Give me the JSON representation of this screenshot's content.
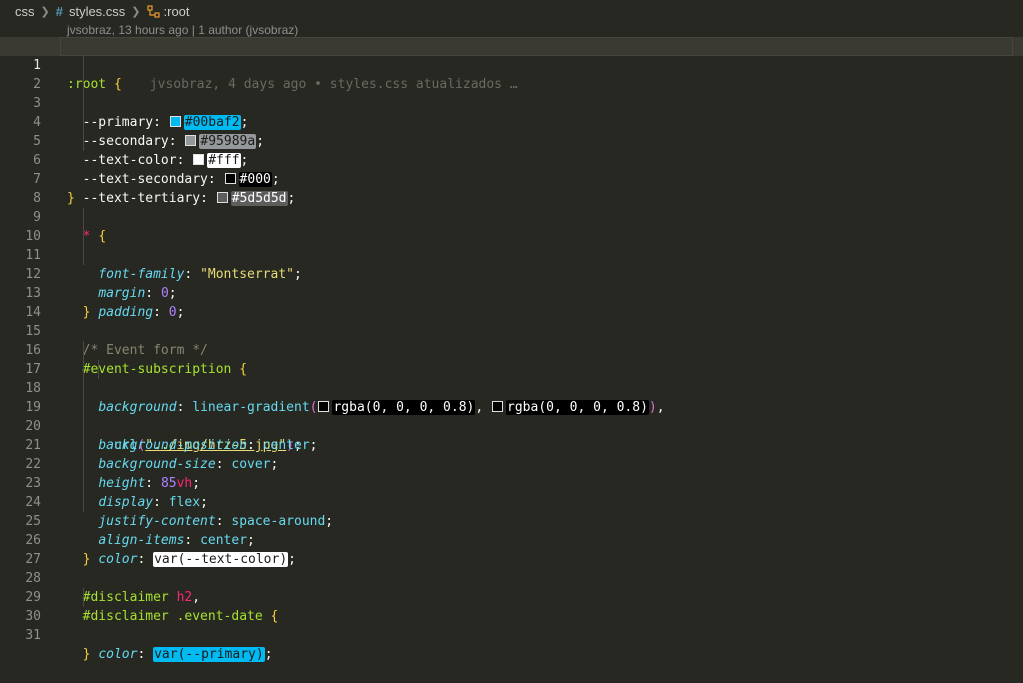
{
  "breadcrumb": {
    "folder": "css",
    "file": "styles.css",
    "symbol": ":root"
  },
  "codelens": "jvsobraz, 13 hours ago | 1 author (jvsobraz)",
  "blame": "jvsobraz, 4 days ago • styles.css atualizados …",
  "colors": {
    "background": "#272822",
    "primary_chip": "#00baf2",
    "secondary_chip": "#95989a",
    "tertiary_chip": "#5d5d5d"
  },
  "line_numbers": [
    "1",
    "2",
    "3",
    "4",
    "5",
    "6",
    "7",
    "8",
    "9",
    "10",
    "11",
    "12",
    "13",
    "14",
    "15",
    "16",
    "17",
    "18",
    "19",
    "20",
    "21",
    "22",
    "23",
    "24",
    "25",
    "26",
    "27",
    "28",
    "29",
    "30",
    "31"
  ],
  "code": {
    "l1_sel": ":root",
    "l1_brace": " {",
    "l2_var": "--primary",
    "l2_val": "#00baf2",
    "l3_var": "--secondary",
    "l3_val": "#95989a",
    "l4_var": "--text-color",
    "l4_val": "#fff",
    "l5_var": "--text-secondary",
    "l5_val": "#000",
    "l6_var": "--text-tertiary",
    "l6_val": "#5d5d5d",
    "close": "}",
    "open": "{",
    "l9_sel": "*",
    "l10_prop": "font-family",
    "l10_val": "\"Montserrat\"",
    "l11_prop": "margin",
    "l11_val": "0",
    "l12_prop": "padding",
    "l12_val": "0",
    "l15_comment": "/* Event form */",
    "l16_sel": "#event-subscription",
    "l17_prop": "background",
    "l17_fn": "linear-gradient",
    "l17_rgba1": "rgba(0, 0, 0, 0.8)",
    "l17_rgba2": "rgba(0, 0, 0, 0.8)",
    "l18_fn": "url",
    "l18_str": "\"../img/hrz-5.jpg\"",
    "l19_prop": "background-position",
    "l19_val": "center",
    "l20_prop": "background-size",
    "l20_val": "cover",
    "l21_prop": "height",
    "l21_num": "85",
    "l21_unit": "vh",
    "l22_prop": "display",
    "l22_val": "flex",
    "l23_prop": "justify-content",
    "l23_val": "space-around",
    "l24_prop": "align-items",
    "l24_val": "center",
    "l25_prop": "color",
    "l25_val": "var(--text-color)",
    "l28_sel": "#disclaimer",
    "l28_tag": "h2",
    "l29_sel": "#disclaimer",
    "l29_cls": ".event-date",
    "l30_prop": "color",
    "l30_val": "var(--primary)"
  }
}
